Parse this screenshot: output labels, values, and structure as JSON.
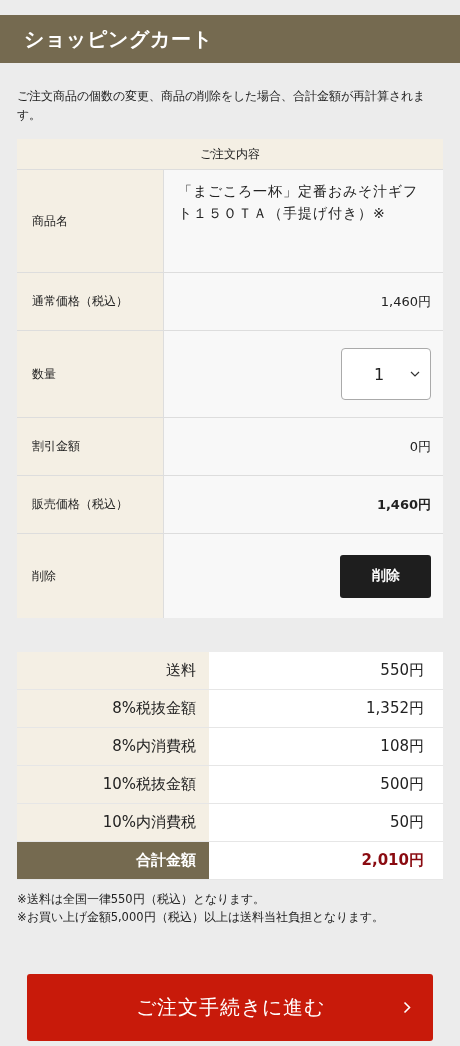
{
  "page_title": "ショッピングカート",
  "intro": "ご注文商品の個数の変更、商品の削除をした場合、合計金額が再計算されます。",
  "order": {
    "heading": "ご注文内容",
    "rows": [
      {
        "kind": "text",
        "label": "商品名",
        "value": "「まごころ一杯」定番おみそ汁ギフト１５０ＴＡ（手提げ付き）※"
      },
      {
        "kind": "price",
        "label": "通常価格（税込）",
        "value": "1,460円"
      },
      {
        "kind": "select",
        "label": "数量",
        "value": "1"
      },
      {
        "kind": "price",
        "label": "割引金額",
        "value": "0円"
      },
      {
        "kind": "strong",
        "label": "販売価格（税込）",
        "value": "1,460円"
      },
      {
        "kind": "button",
        "label": "削除",
        "value": "削除"
      }
    ]
  },
  "summary": [
    {
      "kind": "line",
      "label": "送料",
      "value": "550円"
    },
    {
      "kind": "line",
      "label": "8%税抜金額",
      "value": "1,352円"
    },
    {
      "kind": "line",
      "label": "8%内消費税",
      "value": "108円"
    },
    {
      "kind": "line",
      "label": "10%税抜金額",
      "value": "500円"
    },
    {
      "kind": "line",
      "label": "10%内消費税",
      "value": "50円"
    },
    {
      "kind": "total",
      "label": "合計金額",
      "value": "2,010円"
    }
  ],
  "notes": [
    "※送料は全国一律550円（税込）となります。",
    "※お買い上げ金額5,000円（税込）以上は送料当社負担となります。"
  ],
  "checkout_button": "ご注文手続きに進む"
}
